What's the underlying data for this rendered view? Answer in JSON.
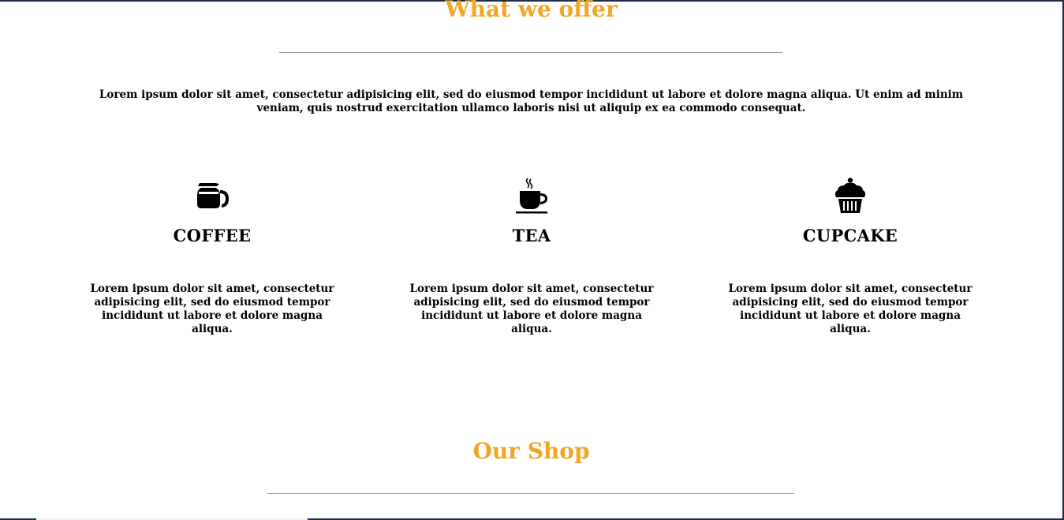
{
  "offer_section": {
    "title": "What we offer",
    "intro": "Lorem ipsum dolor sit amet, consectetur adipisicing elit, sed do eiusmod tempor incididunt ut labore et dolore magna aliqua. Ut enim ad minim veniam, quis nostrud exercitation ullamco laboris nisi ut aliquip ex ea commodo consequat.",
    "items": [
      {
        "icon": "coffee-pot-icon",
        "name": "COFFEE",
        "description": "Lorem ipsum dolor sit amet, consectetur adipisicing elit, sed do eiusmod tempor incididunt ut labore et dolore magna aliqua."
      },
      {
        "icon": "tea-cup-icon",
        "name": "TEA",
        "description": "Lorem ipsum dolor sit amet, consectetur adipisicing elit, sed do eiusmod tempor incididunt ut labore et dolore magna aliqua."
      },
      {
        "icon": "cupcake-icon",
        "name": "CUPCAKE",
        "description": "Lorem ipsum dolor sit amet, consectetur adipisicing elit, sed do eiusmod tempor incididunt ut labore et dolore magna aliqua."
      }
    ]
  },
  "shop_section": {
    "title": "Our Shop"
  },
  "colors": {
    "accent": "#f3a625",
    "text": "#000000",
    "divider": "#9a9a9a",
    "frame": "#1f2d44"
  }
}
